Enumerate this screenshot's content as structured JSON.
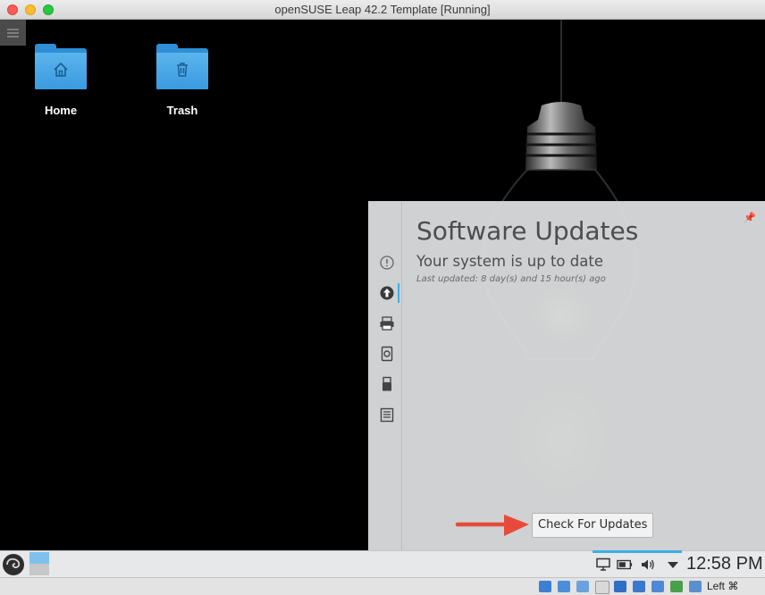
{
  "window": {
    "title": "openSUSE Leap 42.2 Template [Running]"
  },
  "desktop": {
    "icons": [
      {
        "label": "Home",
        "icon": "home-icon"
      },
      {
        "label": "Trash",
        "icon": "trash-icon"
      }
    ]
  },
  "updates": {
    "title": "Software Updates",
    "status": "Your system is up to date",
    "last_updated": "Last updated: 8 day(s) and 15 hour(s) ago",
    "check_button": "Check For Updates",
    "tabs": [
      "notifications-icon",
      "updates-icon",
      "printer-icon",
      "device-notifier-icon",
      "usb-icon",
      "clipboard-icon"
    ]
  },
  "panel": {
    "clock": "12:58 PM"
  },
  "statusbar": {
    "host_key": "Left ⌘"
  },
  "colors": {
    "accent": "#3daee9",
    "arrow": "#e8493a",
    "folder": "#3a9be0"
  }
}
